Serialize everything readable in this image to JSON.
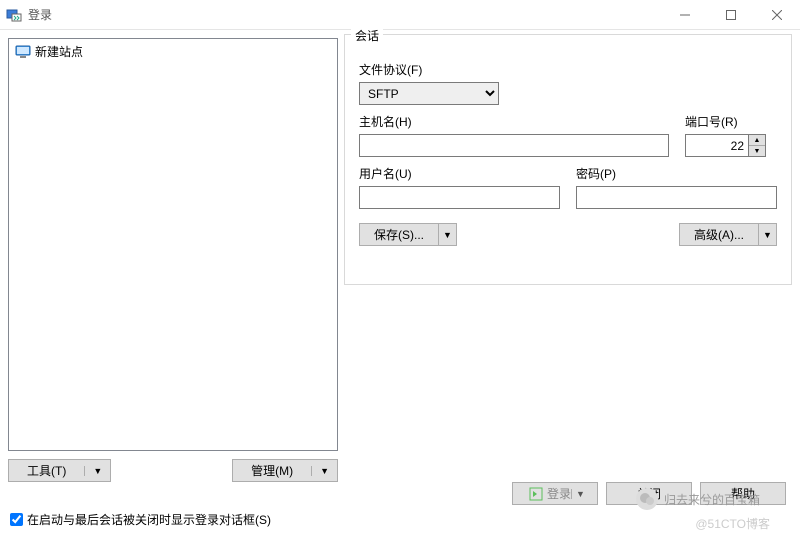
{
  "title": "登录",
  "site_list": {
    "items": [
      {
        "label": "新建站点"
      }
    ]
  },
  "left_buttons": {
    "tools": "工具(T)",
    "manage": "管理(M)"
  },
  "session": {
    "group_title": "会话",
    "protocol_label": "文件协议(F)",
    "protocol_value": "SFTP",
    "host_label": "主机名(H)",
    "host_value": "",
    "port_label": "端口号(R)",
    "port_value": "22",
    "user_label": "用户名(U)",
    "user_value": "",
    "pass_label": "密码(P)",
    "pass_value": "",
    "save_btn": "保存(S)...",
    "advanced_btn": "高级(A)..."
  },
  "footer": {
    "login_btn": "登录",
    "close_btn": "关闭",
    "help_btn": "帮助",
    "checkbox_label": "在启动与最后会话被关闭时显示登录对话框(S)",
    "checkbox_checked": true
  },
  "watermarks": {
    "brand": "归去来兮的百宝箱",
    "credit": "@51CTO博客"
  }
}
